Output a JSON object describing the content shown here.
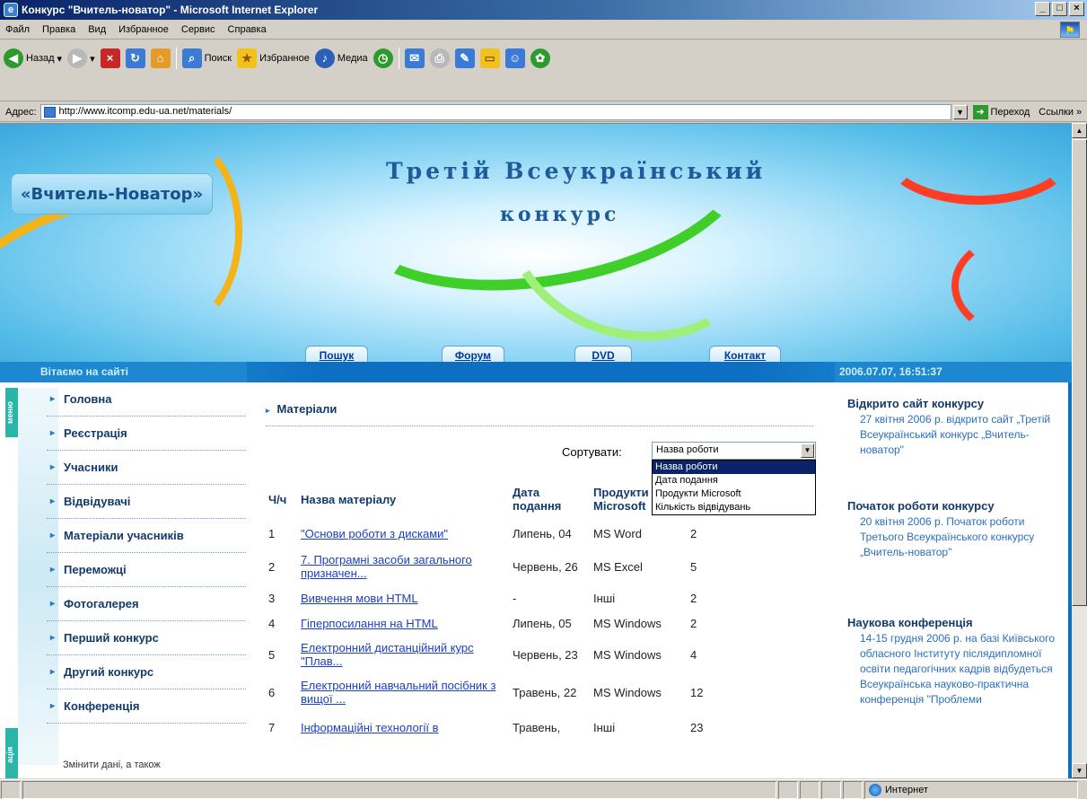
{
  "window": {
    "title": "Конкурс \"Вчитель-новатор\" - Microsoft Internet Explorer",
    "buttons": [
      "_",
      "□",
      "×"
    ]
  },
  "menubar": [
    "Файл",
    "Правка",
    "Вид",
    "Избранное",
    "Сервис",
    "Справка"
  ],
  "toolbar": {
    "back": "Назад",
    "search": "Поиск",
    "favorites": "Избранное",
    "media": "Медиа"
  },
  "address": {
    "label": "Адрес:",
    "url": "http://www.itcomp.edu-ua.net/materials/",
    "go": "Переход",
    "links": "Ссылки »"
  },
  "banner": {
    "logo": "«Вчитель-Новатор»",
    "title_line1": "Третій Всеукраїнський",
    "title_line2": "конкурс",
    "nav": [
      "Пошук",
      "Форум",
      "DVD",
      "Контакт"
    ]
  },
  "strip": {
    "welcome": "Вітаємо на сайті",
    "datetime": "2006.07.07, 16:51:37"
  },
  "left": {
    "tab_top": "меню",
    "tab_bottom": "ація",
    "menu": [
      "Головна",
      "Реєстрація",
      "Учасники",
      "Відвідувачі",
      "Матеріали учасників",
      "Переможці",
      "Фотогалерея",
      "Перший конкурс",
      "Другий конкурс",
      "Конференція"
    ],
    "note": "Змінити дані, а також"
  },
  "main": {
    "heading": "Матеріали",
    "sort_label": "Сортувати:",
    "sort_value": "Назва роботи",
    "sort_options": [
      "Назва роботи",
      "Дата подання",
      "Продукти Microsoft",
      "Кількість відвідувань"
    ],
    "columns": [
      "Ч/ч",
      "Назва матеріалу",
      "Дата подання",
      "Продукти Microsoft",
      ""
    ],
    "rows": [
      {
        "n": "1",
        "title": "\"Основи роботи з дисками\"",
        "date": "Липень, 04",
        "product": "MS Word",
        "visits": "2"
      },
      {
        "n": "2",
        "title": "7. Програмні засоби загального призначен...",
        "date": "Червень, 26",
        "product": "MS Excel",
        "visits": "5"
      },
      {
        "n": "3",
        "title": "Вивчення мови HTML",
        "date": "-",
        "product": "Інші",
        "visits": "2"
      },
      {
        "n": "4",
        "title": "Гіперпосилання на HTML",
        "date": "Липень, 05",
        "product": "MS Windows",
        "visits": "2"
      },
      {
        "n": "5",
        "title": "Електронний дистанційний курс \"Плав...",
        "date": "Червень, 23",
        "product": "MS Windows",
        "visits": "4"
      },
      {
        "n": "6",
        "title": "Електронний навчальний посібник з вищої ...",
        "date": "Травень, 22",
        "product": "MS Windows",
        "visits": "12"
      },
      {
        "n": "7",
        "title": "Інформаційні технології в",
        "date": "Травень,",
        "product": "Інші",
        "visits": "23"
      }
    ]
  },
  "right": {
    "news": [
      {
        "title": "Відкрито сайт конкурсу",
        "text": "27 квітня 2006 р. відкрито сайт „Третій Всеукраїнський конкурс „Вчитель-новатор\""
      },
      {
        "title": "Початок роботи конкурсу",
        "text": "20 квітня 2006 р. Початок роботи Третього Всеукраїнського конкурсу „Вчитель-новатор\""
      },
      {
        "title": "Наукова конференція",
        "text": "14-15 грудня 2006 р. на базі Київського обласного Інституту післядипломної освіти педагогічних кадрів відбудеться Всеукраїнська науково-практична конференція \"Проблеми"
      }
    ]
  },
  "status": {
    "zone": "Интернет"
  }
}
